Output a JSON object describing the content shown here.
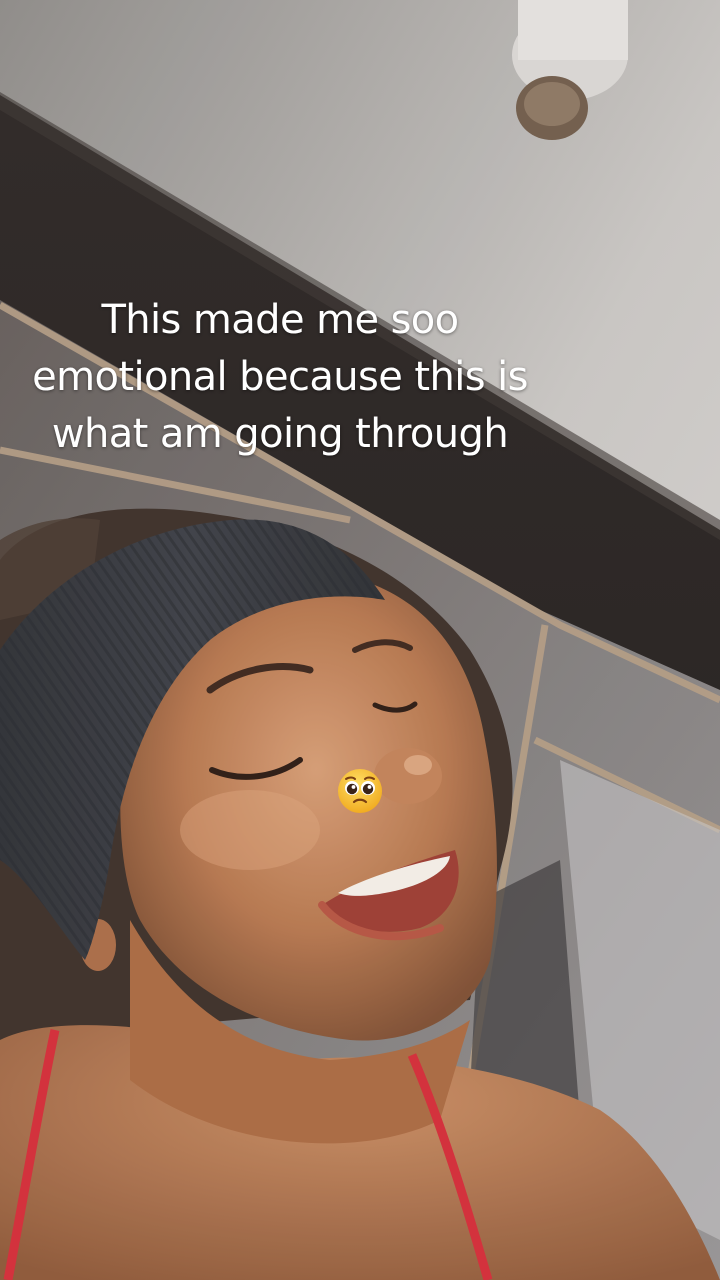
{
  "caption": {
    "text": "This made me soo\nemotional because this is\nwhat am going through"
  },
  "sticker": {
    "icon": "pleading-face-emoji-icon"
  },
  "colors": {
    "caption_text": "#ffffff",
    "headband": "#33353b",
    "strap": "#d22a36",
    "skin": "#b5754c"
  }
}
